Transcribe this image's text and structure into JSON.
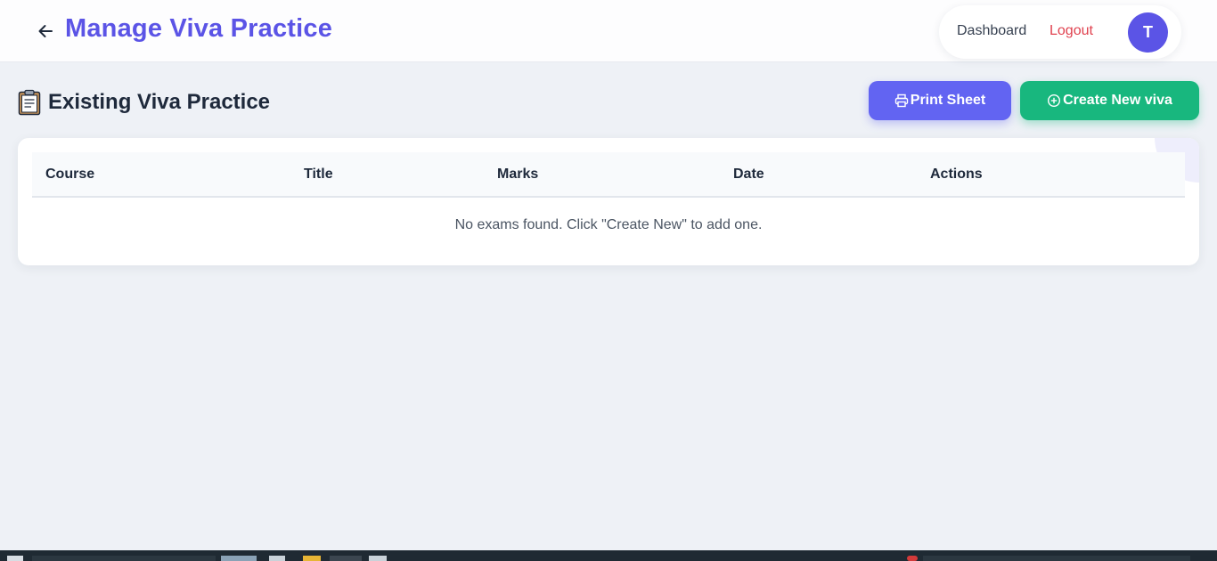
{
  "header": {
    "title": "Manage Viva Practice",
    "back_icon": "arrow-left-icon",
    "nav": {
      "dashboard_label": "Dashboard",
      "logout_label": "Logout",
      "avatar_initial": "T"
    }
  },
  "section": {
    "icon": "clipboard-icon",
    "title": "Existing Viva Practice",
    "print_button_label": "Print Sheet",
    "create_button_label": "Create New viva"
  },
  "table": {
    "columns": [
      "Course",
      "Title",
      "Marks",
      "Date",
      "Actions"
    ],
    "empty_message": "No exams found. Click \"Create New\" to add one."
  },
  "colors": {
    "accent": "#5b54e6",
    "print_button": "#6264f2",
    "create_button": "#18b77e",
    "logout": "#e0424f",
    "page_background": "#eef1f6"
  }
}
